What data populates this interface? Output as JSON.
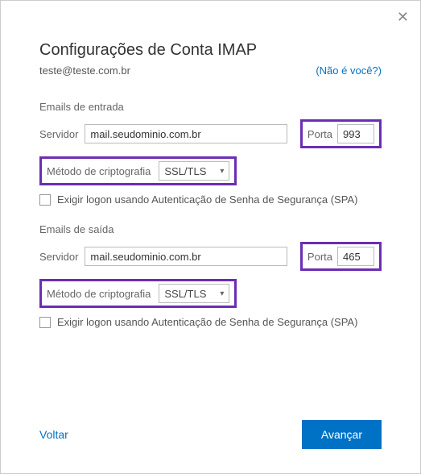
{
  "dialog": {
    "title": "Configurações de Conta IMAP",
    "email": "teste@teste.com.br",
    "not_you_link": "(Não é você?)"
  },
  "incoming": {
    "section_label": "Emails de entrada",
    "server_label": "Servidor",
    "server_value": "mail.seudominio.com.br",
    "port_label": "Porta",
    "port_value": "993",
    "crypto_label": "Método de criptografia",
    "crypto_value": "SSL/TLS",
    "spa_label": "Exigir logon usando Autenticação de Senha de Segurança (SPA)"
  },
  "outgoing": {
    "section_label": "Emails de saída",
    "server_label": "Servidor",
    "server_value": "mail.seudominio.com.br",
    "port_label": "Porta",
    "port_value": "465",
    "crypto_label": "Método de criptografia",
    "crypto_value": "SSL/TLS",
    "spa_label": "Exigir logon usando Autenticação de Senha de Segurança (SPA)"
  },
  "footer": {
    "back": "Voltar",
    "next": "Avançar"
  },
  "highlight_color": "#6b2db3",
  "accent_color": "#0072c6"
}
